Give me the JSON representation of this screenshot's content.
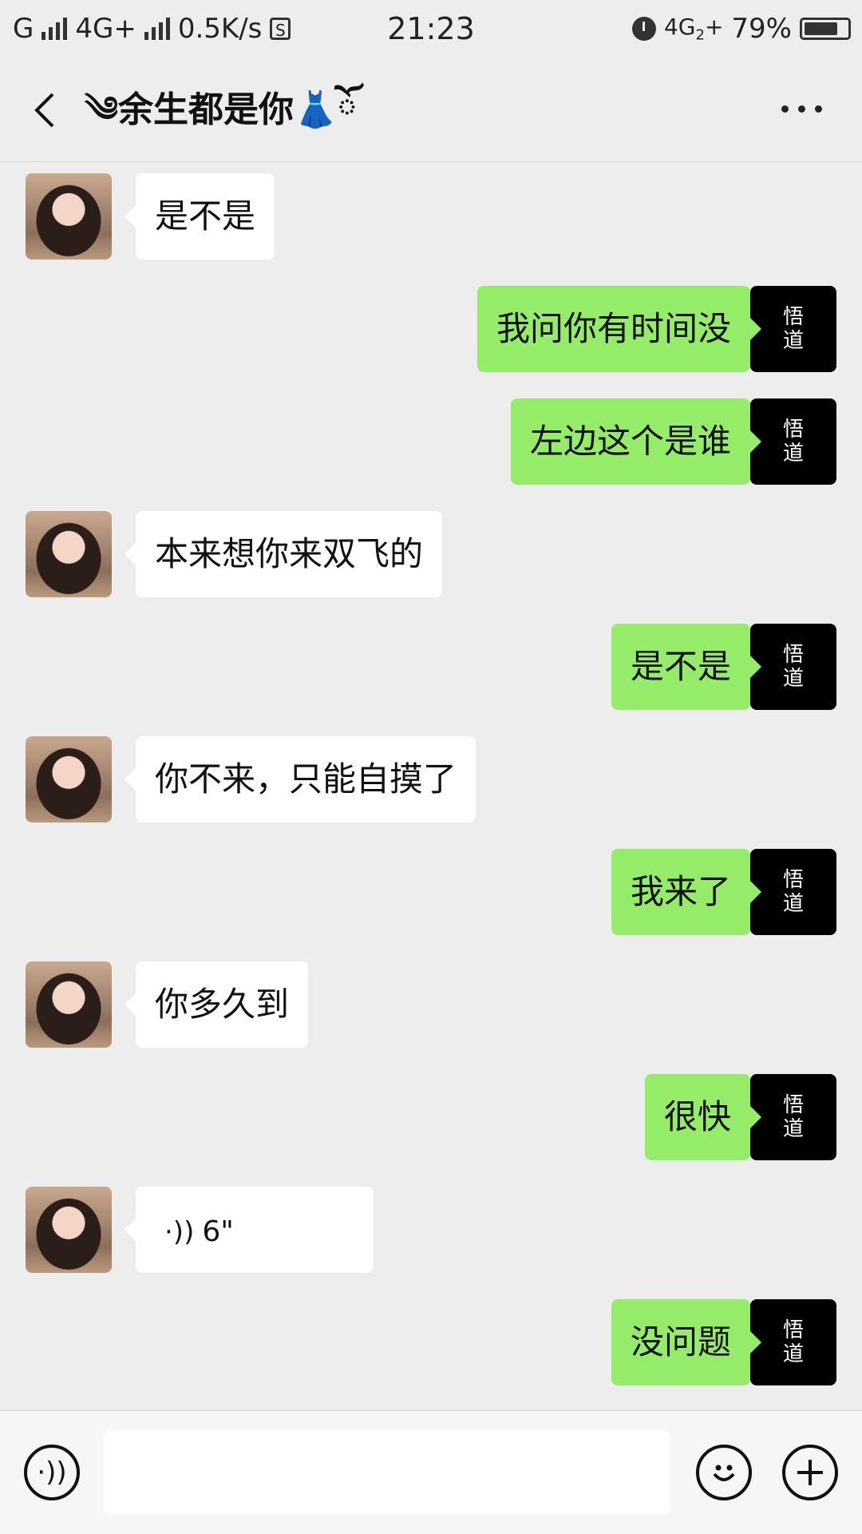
{
  "status_bar": {
    "network_1": "G",
    "network_2": "4G+",
    "speed": "0.5K/s",
    "s_badge": "S",
    "time": "21:23",
    "network_3": "4G",
    "sim_2": "2",
    "network_3_plus": "+",
    "battery": "79%",
    "battery_level": 0.79
  },
  "header": {
    "title": "༄余生都是你👗ོ"
  },
  "avatar_me_text": [
    "悟",
    "道"
  ],
  "messages": [
    {
      "side": "left",
      "text": "是不是"
    },
    {
      "side": "right",
      "text": "我问你有时间没"
    },
    {
      "side": "right",
      "text": "左边这个是谁"
    },
    {
      "side": "left",
      "text": "本来想你来双飞的"
    },
    {
      "side": "right",
      "text": "是不是"
    },
    {
      "side": "left",
      "text": "你不来，只能自摸了"
    },
    {
      "side": "right",
      "text": "我来了"
    },
    {
      "side": "left",
      "text": "你多久到"
    },
    {
      "side": "right",
      "text": "很快"
    },
    {
      "side": "left",
      "type": "voice",
      "text": "6\""
    },
    {
      "side": "right",
      "text": "没问题"
    }
  ],
  "icons": {
    "back": "chevron-left-icon",
    "more": "more-dots-icon",
    "voice_input": "voice-icon",
    "emoji": "emoji-icon",
    "plus": "plus-icon"
  },
  "colors": {
    "background": "#ededed",
    "my_bubble": "#95ec69",
    "their_bubble": "#ffffff"
  }
}
